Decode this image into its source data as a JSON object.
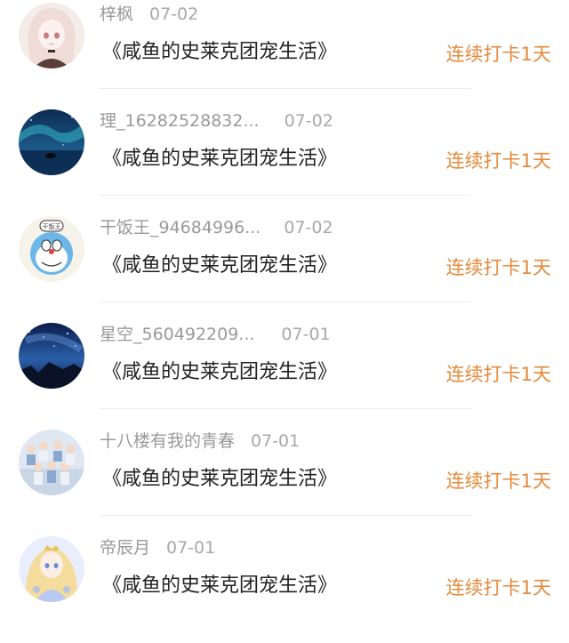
{
  "colors": {
    "accent": "#e58a3c",
    "meta": "#9a9a9a",
    "title": "#222222"
  },
  "entries": [
    {
      "name": "梓枫",
      "date": "07-02",
      "title": "《咸鱼的史莱克团宠生活》",
      "streak": "连续打卡1天",
      "avatar": "anime-girl-avatar"
    },
    {
      "name": "理_16282528832...",
      "date": "07-02",
      "title": "《咸鱼的史莱克团宠生活》",
      "streak": "连续打卡1天",
      "avatar": "aurora-night-avatar"
    },
    {
      "name": "干饭王_94684996...",
      "date": "07-02",
      "title": "《咸鱼的史莱克团宠生活》",
      "streak": "连续打卡1天",
      "avatar": "doraemon-avatar",
      "avatar_text": "干饭王"
    },
    {
      "name": "星空_560492209...",
      "date": "07-01",
      "title": "《咸鱼的史莱克团宠生活》",
      "streak": "连续打卡1天",
      "avatar": "starry-sky-avatar"
    },
    {
      "name": "十八楼有我的青春",
      "date": "07-01",
      "title": "《咸鱼的史莱克团宠生活》",
      "streak": "连续打卡1天",
      "avatar": "group-photo-avatar"
    },
    {
      "name": "帝辰月",
      "date": "07-01",
      "title": "《咸鱼的史莱克团宠生活》",
      "streak": "连续打卡1天",
      "avatar": "anime-princess-avatar"
    }
  ]
}
